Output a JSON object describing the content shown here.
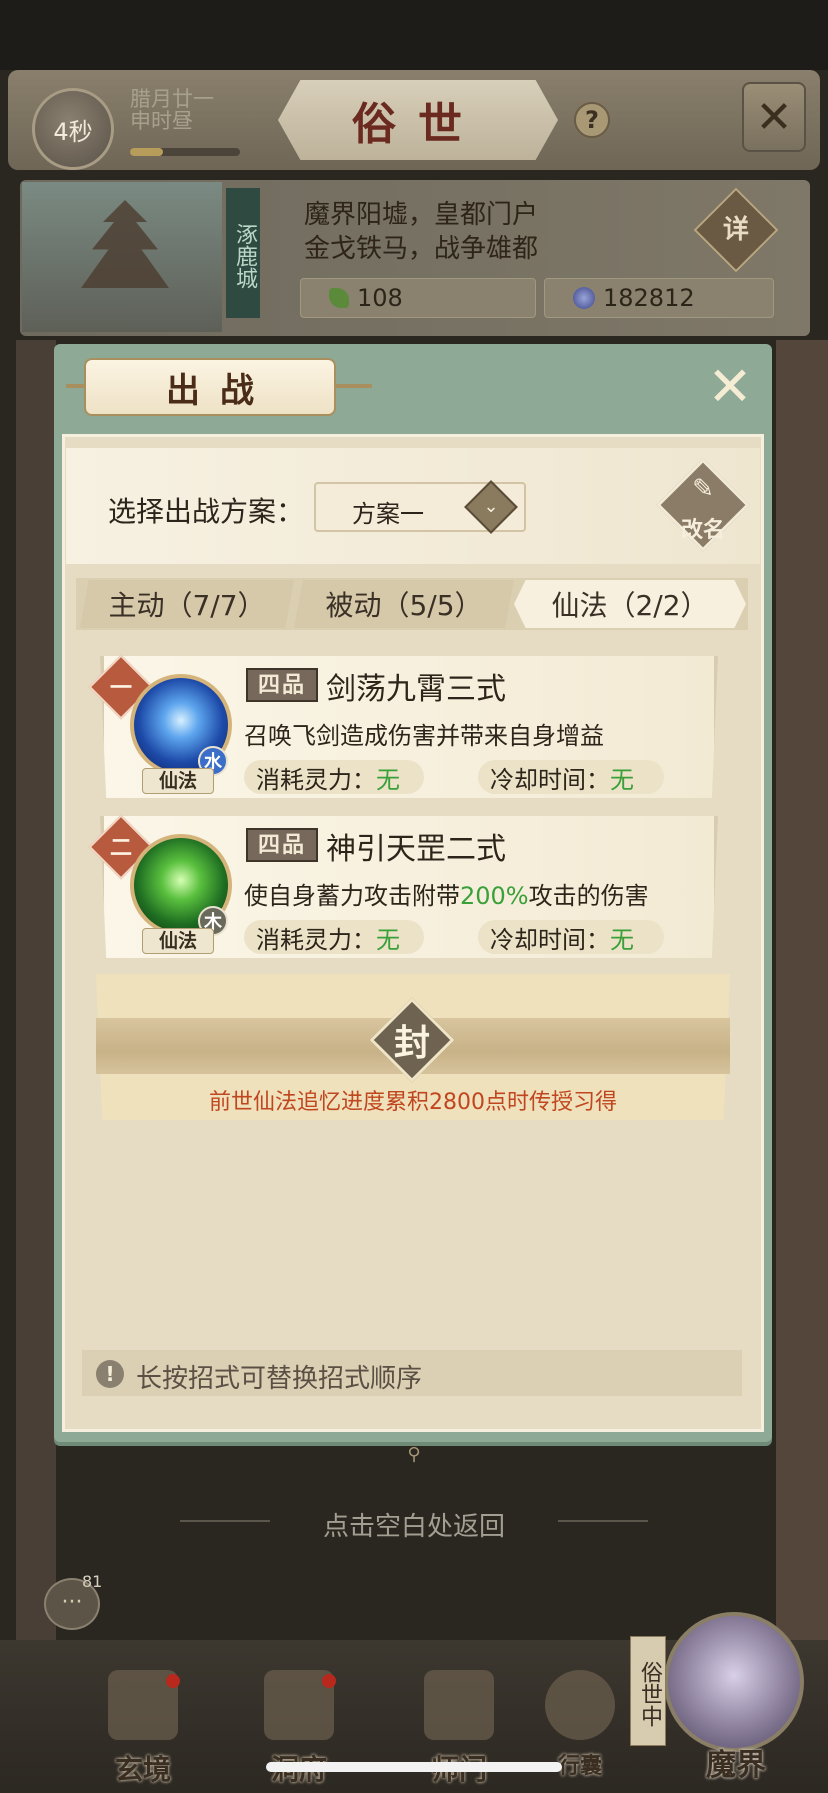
{
  "header": {
    "timer": "4秒",
    "lunar_date_line1": "腊月廿一",
    "lunar_date_line2": "申时昼",
    "title": "俗世",
    "help_icon": "question-icon",
    "close_icon": "crossed-swords-icon"
  },
  "city": {
    "name": "涿鹿城",
    "desc_line1": "魔界阳墟，皇都门户",
    "desc_line2": "金戈铁马，战争雄都",
    "detail_label": "详",
    "jade": "108",
    "coins": "182812"
  },
  "modal": {
    "title": "出战",
    "scheme_label": "选择出战方案：",
    "scheme_value": "方案一",
    "rename_label": "改名",
    "tabs": [
      {
        "label": "主动（7/7）",
        "active": false
      },
      {
        "label": "被动（5/5）",
        "active": false
      },
      {
        "label": "仙法（2/2）",
        "active": true
      }
    ],
    "skills": [
      {
        "order": "一",
        "grade": "四品",
        "name": "剑荡九霄三式",
        "desc": "召唤飞剑造成伤害并带来自身增益",
        "element": "水",
        "type": "仙法",
        "cost_label": "消耗灵力：",
        "cost_value": "无",
        "cooldown_label": "冷却时间：",
        "cooldown_value": "无"
      },
      {
        "order": "二",
        "grade": "四品",
        "name": "神引天罡二式",
        "desc_before": "使自身蓄力攻击附带",
        "desc_highlight": "200%",
        "desc_after": "攻击的伤害",
        "element": "木",
        "type": "仙法",
        "cost_label": "消耗灵力：",
        "cost_value": "无",
        "cooldown_label": "冷却时间：",
        "cooldown_value": "无"
      }
    ],
    "sealed": {
      "char": "封",
      "text": "前世仙法追忆进度累积2800点时传授习得"
    },
    "hint": "长按招式可替换招式顺序"
  },
  "return_hint": "点击空白处返回",
  "chat_count": "81",
  "nav": {
    "items": [
      {
        "label": "玄境"
      },
      {
        "label": "洞府"
      },
      {
        "label": "师门"
      },
      {
        "label": "行囊"
      }
    ],
    "realm_tag": "俗世中",
    "realm_label": "魔界"
  },
  "colors": {
    "highlight_green": "#3aa03a",
    "seal_red": "#c0461f",
    "modal_green": "#8ea995"
  }
}
